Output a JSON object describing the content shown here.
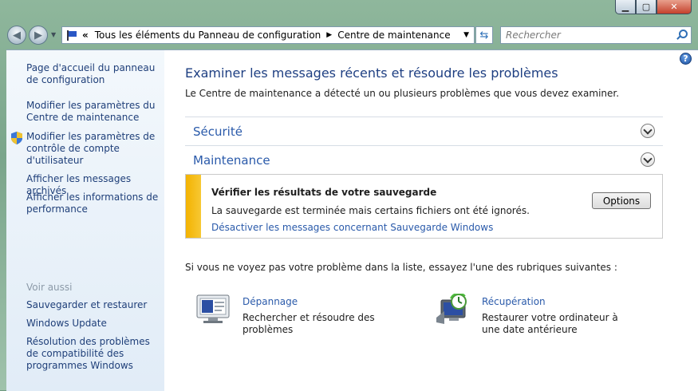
{
  "window": {
    "minimize_icon": "minimize-icon",
    "maximize_icon": "maximize-icon",
    "close_icon": "close-icon"
  },
  "nav": {
    "breadcrumb_root": "«",
    "breadcrumb": [
      "Tous les éléments du Panneau de configuration",
      "Centre de maintenance"
    ],
    "search_placeholder": "Rechercher"
  },
  "sidebar": {
    "links": [
      "Page d'accueil du panneau de configuration",
      "Modifier les paramètres du Centre de maintenance",
      "Modifier les paramètres de contrôle de compte d'utilisateur",
      "Afficher les messages archivés",
      "Afficher les informations de performance"
    ],
    "see_also_label": "Voir aussi",
    "see_also": [
      "Sauvegarder et restaurer",
      "Windows Update",
      "Résolution des problèmes de compatibilité des programmes Windows"
    ]
  },
  "main": {
    "title": "Examiner les messages récents et résoudre les problèmes",
    "subtitle": "Le Centre de maintenance a détecté un ou plusieurs problèmes que vous devez examiner.",
    "sections": [
      "Sécurité",
      "Maintenance"
    ],
    "alert": {
      "title": "Vérifier les résultats de votre sauvegarde",
      "description": "La sauvegarde est terminée mais certains fichiers ont été ignorés.",
      "link": "Désactiver les messages concernant Sauvegarde Windows",
      "button": "Options",
      "color": "#f3b200"
    },
    "hint": "Si vous ne voyez pas votre problème dans la liste, essayez l'une des rubriques suivantes :",
    "tools": [
      {
        "name": "Dépannage",
        "description": "Rechercher et résoudre des problèmes"
      },
      {
        "name": "Récupération",
        "description": "Restaurer votre ordinateur à une date antérieure"
      }
    ]
  },
  "colors": {
    "link": "#2a5aaa",
    "title": "#1e3f82",
    "sidebar_link": "#1f3f79"
  }
}
